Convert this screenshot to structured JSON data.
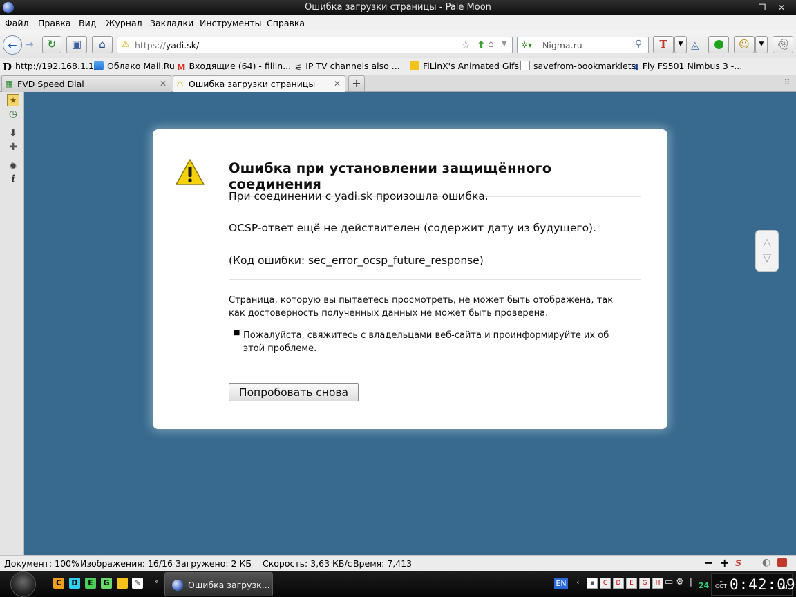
{
  "window": {
    "title": "Ошибка загрузки страницы - Pale Moon",
    "min": "—",
    "max": "❐",
    "close": "✕"
  },
  "menu": [
    "Файл",
    "Правка",
    "Вид",
    "Журнал",
    "Закладки",
    "Инструменты",
    "Справка"
  ],
  "navbar": {
    "url_scheme": "https://",
    "url_host": "yadi.sk/",
    "search_placeholder": "Nigma.ru"
  },
  "bookmarks": [
    {
      "label": "http://192.168.1.1/",
      "icon": "d-letter-icon"
    },
    {
      "label": "Облако Mail.Ru",
      "icon": "cloud-icon"
    },
    {
      "label": "Входящие (64) - fillin...",
      "icon": "gmail-icon"
    },
    {
      "label": "IP TV channels also ...",
      "icon": "satellite-icon"
    },
    {
      "label": "FiLinX's Animated Gifs",
      "icon": "folder-icon"
    },
    {
      "label": "savefrom-bookmarklets",
      "icon": "page-icon"
    },
    {
      "label": "Fly FS501 Nimbus 3 -...",
      "icon": "4pda-icon"
    }
  ],
  "tabs": [
    {
      "label": "FVD Speed Dial",
      "active": false
    },
    {
      "label": "Ошибка загрузки страницы",
      "active": true
    }
  ],
  "new_tab": "+",
  "error": {
    "title": "Ошибка при установлении защищённого соединения",
    "line1": "При соединении с yadi.sk произошла ошибка.",
    "line2": "OCSP-ответ ещё не действителен (содержит дату из будущего).",
    "line3": "(Код ошибки: sec_error_ocsp_future_response)",
    "explanation": "Страница, которую вы пытаетесь просмотреть, не может быть отображена, так как достоверность полученных данных не может быть проверена.",
    "bullet": "Пожалуйста, свяжитесь с владельцами веб-сайта и проинформируйте их об этой проблеме.",
    "retry_button": "Попробовать снова"
  },
  "status": {
    "document": "Документ: 100%",
    "images": "Изображения: 16/16",
    "loaded": "Загружено: 2 КБ",
    "speed": "Скорость: 3,63 КБ/с",
    "time": "Время: 7,413"
  },
  "taskbar": {
    "quick": [
      "C",
      "D",
      "E",
      "G"
    ],
    "task_label": "Ошибка загрузк...",
    "lang": "EN",
    "badge": "24",
    "clock_day": "1",
    "clock_month": "OCT",
    "clock_time": "0:42:09",
    "clock_weekday": "SAT"
  },
  "colors": {
    "content_bg": "#376a8e",
    "warning": "#f5d20c",
    "accent": "#1d5aa8"
  }
}
